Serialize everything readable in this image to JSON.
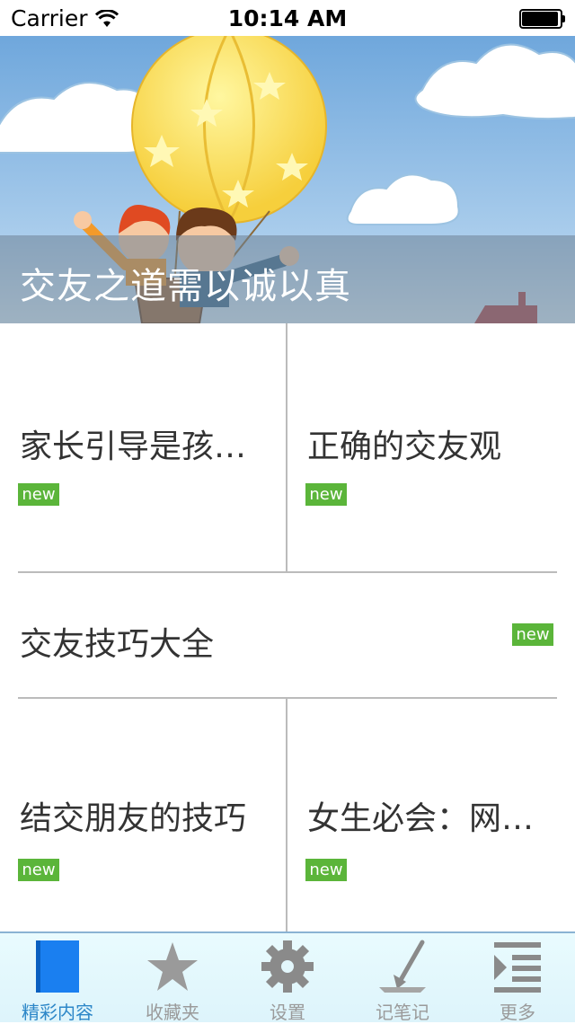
{
  "status_bar": {
    "carrier": "Carrier",
    "time": "10:14 AM"
  },
  "banner": {
    "title": "交友之道需以诚以真"
  },
  "grid": {
    "cells": [
      {
        "title": "家长引导是孩…",
        "badge": "new"
      },
      {
        "title": "正确的交友观",
        "badge": "new"
      },
      {
        "title": "交友技巧大全",
        "badge": "new"
      },
      {
        "title": "结交朋友的技巧",
        "badge": "new"
      },
      {
        "title": "女生必会：网…",
        "badge": "new"
      }
    ]
  },
  "tabbar": {
    "tabs": [
      {
        "label": "精彩内容",
        "icon": "book-icon",
        "active": true
      },
      {
        "label": "收藏夹",
        "icon": "star-icon",
        "active": false
      },
      {
        "label": "设置",
        "icon": "gear-icon",
        "active": false
      },
      {
        "label": "记笔记",
        "icon": "pen-icon",
        "active": false
      },
      {
        "label": "更多",
        "icon": "list-icon",
        "active": false
      }
    ]
  },
  "colors": {
    "badge": "#5bb53a",
    "tab_active": "#2d87c8",
    "tab_inactive": "#9a9a9a"
  }
}
